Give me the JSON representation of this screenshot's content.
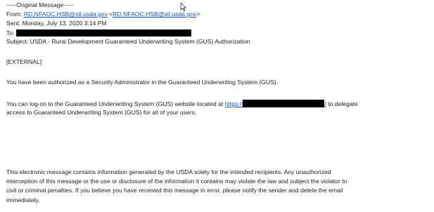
{
  "header": {
    "original_message": "-----Original Message-----",
    "from_label": "From: ",
    "from_link": "RD.NFAOC.HSB@stl.usda.gov",
    "from_open": " <",
    "from_link2": "RD.NFAOC.HSB@stl.usda.gov",
    "from_close": ">",
    "sent_line": "Sent: Monday, July 13, 2020 3:14 PM",
    "to_label": "To: ",
    "subject_line": "Subject: USDA - Rural Development Guaranteed Underwriting System (GUS) Authorization"
  },
  "body": {
    "external_tag": "[EXTERNAL]",
    "authorized_line": "You have been authorized as a Security Administrator in the Guaranteed Underwriting System (GUS).",
    "logon_prefix": "You can log-on to the Guaranteed Underwriting System (GUS) website located at ",
    "logon_link": "https://",
    "logon_link_end": "/",
    "logon_suffix": " to delegate",
    "logon_line2": "access to Guaranteed Underwriting System (GUS) for all of your users.",
    "disclaimer_1": "This electronic message contains information generated by the USDA solely for the intended recipients. Any unauthorized",
    "disclaimer_2": "interception of this message or the use or disclosure of the information it contains may violate the law and subject the violator to",
    "disclaimer_3": "civil or criminal penalties. If you believe you have received this message in error, please notify the sender and delete the email",
    "disclaimer_4": "immediately."
  },
  "colors": {
    "link": "#1155cc",
    "redaction": "#000000",
    "text": "#1a1a1a"
  },
  "icons": {
    "cursor": "mouse-pointer-icon"
  }
}
